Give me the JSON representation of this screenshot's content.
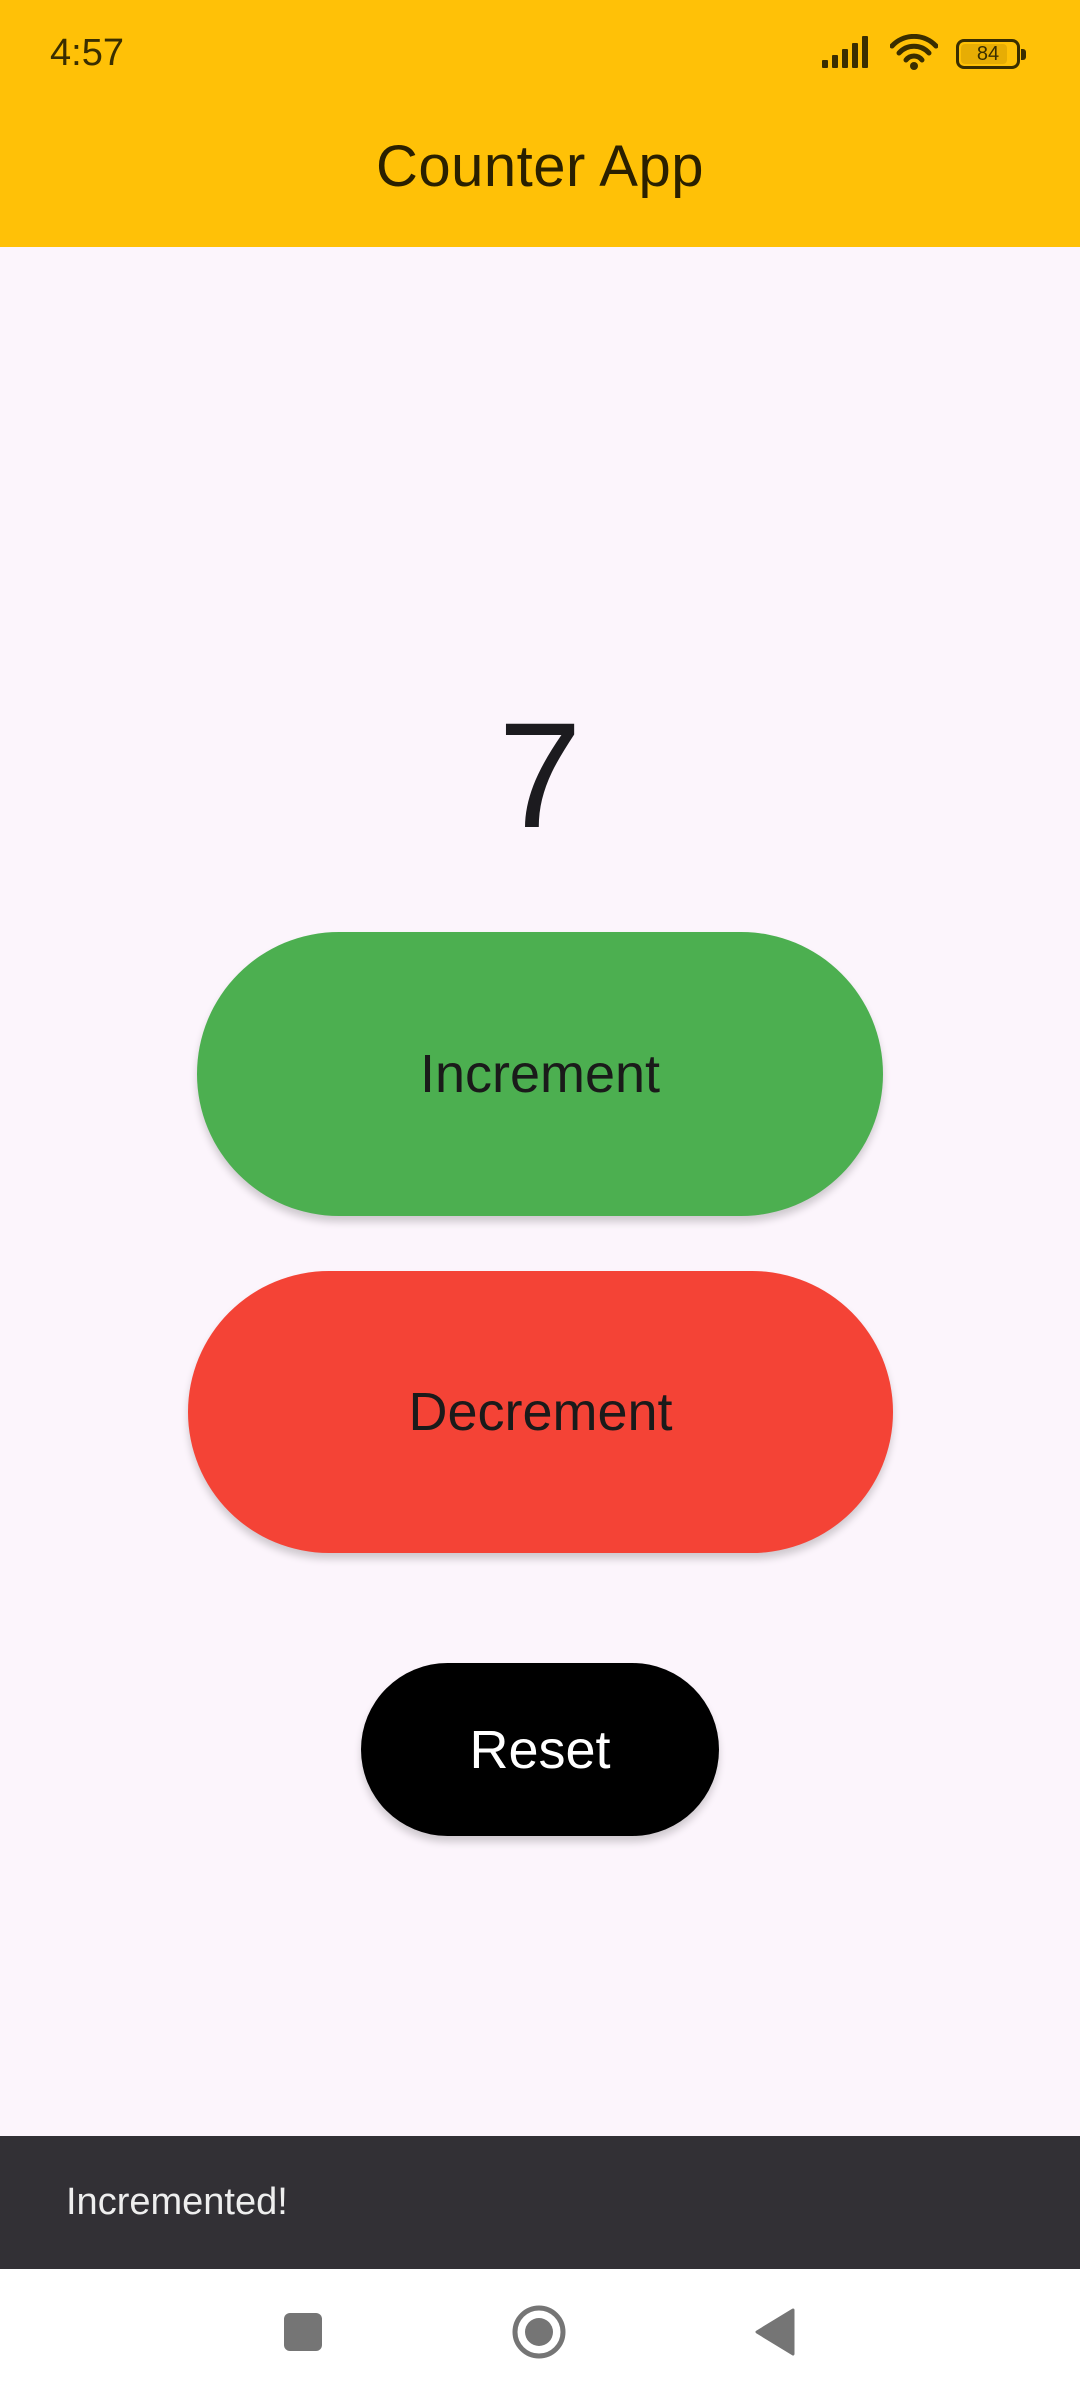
{
  "status_bar": {
    "time": "4:57",
    "battery": "84",
    "icons": [
      "signal-icon",
      "wifi-icon",
      "battery-icon"
    ]
  },
  "app_bar": {
    "title": "Counter App",
    "color": "#FFC107"
  },
  "counter": {
    "value": "7"
  },
  "buttons": {
    "increment": {
      "label": "Increment",
      "color": "#4CAF50"
    },
    "decrement": {
      "label": "Decrement",
      "color": "#F44336"
    },
    "reset": {
      "label": "Reset",
      "color": "#000000"
    }
  },
  "snackbar": {
    "message": "Incremented!"
  },
  "nav_bar": {
    "icons": [
      "recents-icon",
      "home-icon",
      "back-icon"
    ]
  }
}
